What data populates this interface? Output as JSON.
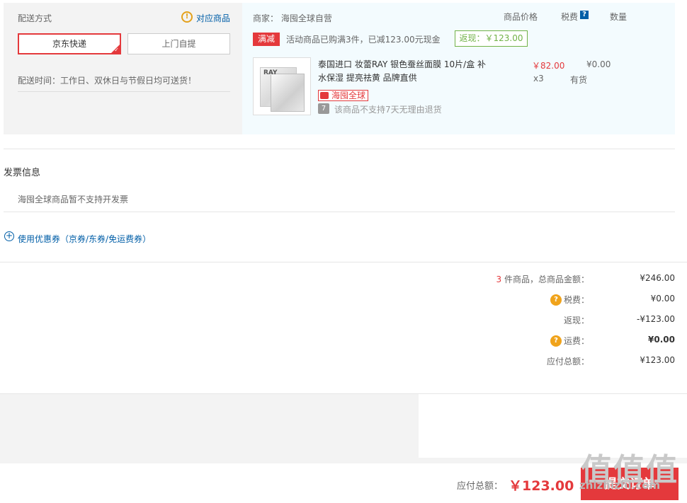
{
  "shipping": {
    "title": "配送方式",
    "match_link": "对应商品",
    "option_express": "京东快递",
    "option_pickup": "上门自提",
    "delivery_time": "配送时间：工作日、双休日与节假日均可送货！"
  },
  "order": {
    "merchant": "商家：  海囤全球自营",
    "col_price": "商品价格",
    "col_tax": "税费",
    "col_qty": "数量",
    "promo_tag": "满减",
    "promo_text": "活动商品已购满3件，已减123.00元现金",
    "rebate": "返现：￥123.00",
    "product": {
      "name": "泰国进口 妆蕾RAY 银色蚕丝面膜 10片/盒 补水保湿 提亮祛黄 品牌直供",
      "price": "￥82.00",
      "tax": "¥0.00",
      "qty": "x3",
      "stock": "有货",
      "global_tag": "海囤全球",
      "no_return_icon": "7",
      "no_return": "该商品不支持7天无理由退货",
      "thumb_brand": "RAY"
    }
  },
  "invoice": {
    "title": "发票信息",
    "note": "海囤全球商品暂不支持开发票"
  },
  "coupon": {
    "link": "使用优惠券（京券/东券/免运费券）"
  },
  "summary": {
    "count": "3",
    "count_suffix": " 件商品，总商品金额：",
    "goods_total": "¥246.00",
    "tax_label": "税费：",
    "tax_value": "¥0.00",
    "rebate_label": "返现：",
    "rebate_value": "-¥123.00",
    "freight_label": "运费：",
    "freight_value": "¥0.00",
    "payable_label": "应付总额：",
    "payable_value": "¥123.00"
  },
  "footer": {
    "total_label": "应付总额：",
    "total_amount": "￥123.00",
    "submit": "提交订单",
    "watermark": "值值值",
    "watermark_url": "zhizhizhi.com"
  },
  "colors": {
    "accent_red": "#e4393c",
    "link_blue": "#005ea7",
    "rebate_green": "#71b247",
    "warn_orange": "#f0a31b"
  },
  "icons": [
    "warning-icon",
    "checkmark-icon",
    "help-icon",
    "plus-icon",
    "global-icon",
    "no-return-icon"
  ]
}
